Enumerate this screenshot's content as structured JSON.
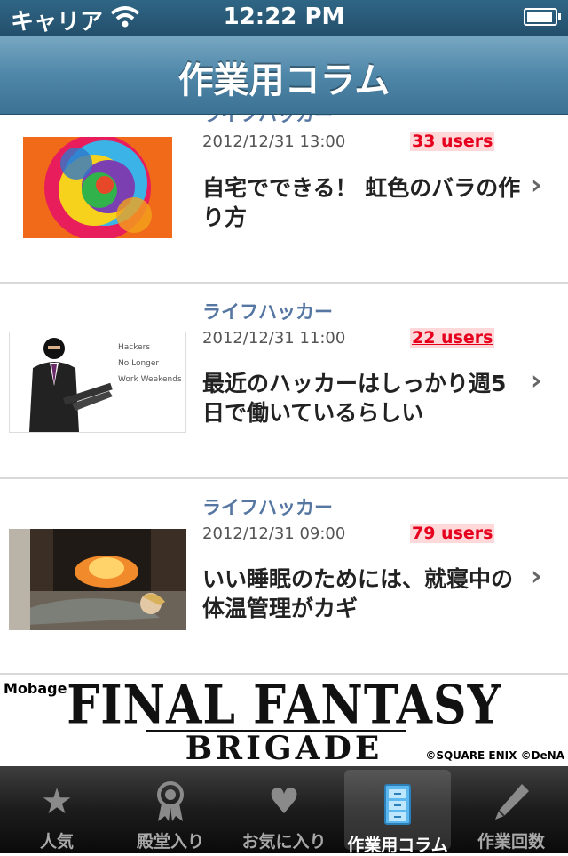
{
  "status": {
    "carrier": "キャリア",
    "time": "12:22 PM"
  },
  "nav": {
    "title": "作業用コラム"
  },
  "articles": [
    {
      "source": "ライフハッカー",
      "date": "2012/12/31 13:00",
      "users": "33 users",
      "title": "自宅でできる！ 虹色のバラの作り方"
    },
    {
      "source": "ライフハッカー",
      "date": "2012/12/31 11:00",
      "users": "22 users",
      "title": "最近のハッカーはしっかり週5日で働いているらしい",
      "thumb_text": [
        "Hackers",
        "No Longer",
        "Work Weekends"
      ]
    },
    {
      "source": "ライフハッカー",
      "date": "2012/12/31 09:00",
      "users": "79 users",
      "title": "いい睡眠のためには、就寝中の体温管理がカギ"
    }
  ],
  "ad": {
    "mobage": "Mobage",
    "title": "FINAL FANTASY",
    "subtitle": "BRIGADE",
    "copyright": "©SQUARE ENIX ©DeNA"
  },
  "tabs": [
    {
      "label": "人気",
      "icon": "star-icon"
    },
    {
      "label": "殿堂入り",
      "icon": "award-icon"
    },
    {
      "label": "お気に入り",
      "icon": "heart-icon"
    },
    {
      "label": "作業用コラム",
      "icon": "cabinet-icon",
      "selected": true
    },
    {
      "label": "作業回数",
      "icon": "pencil-icon"
    }
  ],
  "colors": {
    "accent": "#4f87a9",
    "users_red": "#e6001d",
    "source_blue": "#5577a2"
  }
}
